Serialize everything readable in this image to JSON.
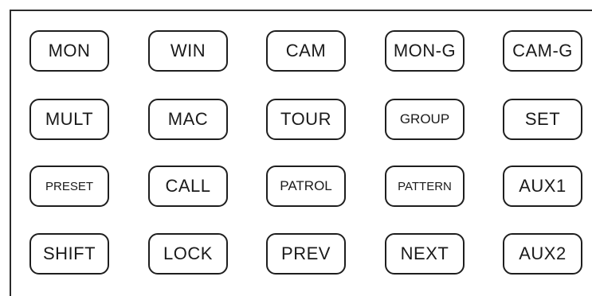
{
  "keypad": {
    "rows": [
      [
        "MON",
        "WIN",
        "CAM",
        "MON-G",
        "CAM-G"
      ],
      [
        "MULT",
        "MAC",
        "TOUR",
        "GROUP",
        "SET"
      ],
      [
        "PRESET",
        "CALL",
        "PATROL",
        "PATTERN",
        "AUX1"
      ],
      [
        "SHIFT",
        "LOCK",
        "PREV",
        "NEXT",
        "AUX2"
      ]
    ]
  },
  "colors": {
    "border": "#1e1e1e",
    "background": "#ffffff",
    "text": "#1a1a1a"
  }
}
